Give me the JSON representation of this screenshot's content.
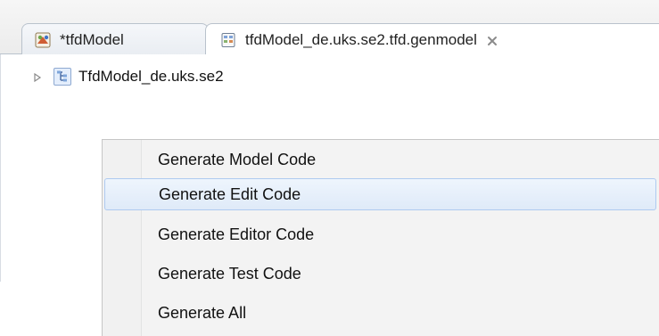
{
  "tabs": [
    {
      "title": "*tfdModel",
      "icon": "ecore-model-icon",
      "active": false
    },
    {
      "title": "tfdModel_de.uks.se2.tfd.genmodel",
      "icon": "genmodel-icon",
      "active": true,
      "close_icon": "close-icon"
    }
  ],
  "tree": {
    "root_label": "TfdModel_de.uks.se2",
    "expand_icon": "triangle-right-icon",
    "node_icon": "package-tree-icon"
  },
  "context_menu": {
    "items": [
      {
        "label": "Generate Model Code",
        "highlighted": false
      },
      {
        "label": "Generate Edit Code",
        "highlighted": true
      },
      {
        "label": "Generate Editor Code",
        "highlighted": false
      },
      {
        "label": "Generate Test Code",
        "highlighted": false
      },
      {
        "label": "Generate All",
        "highlighted": false
      }
    ]
  },
  "colors": {
    "menu_highlight": "#dfeaf8",
    "menu_highlight_border": "#aecaf0",
    "tab_border": "#b9c2cc",
    "arrow_green": "#5ea84f"
  },
  "decorations": {
    "top_arrow_icon": "arrow-down-icon"
  }
}
